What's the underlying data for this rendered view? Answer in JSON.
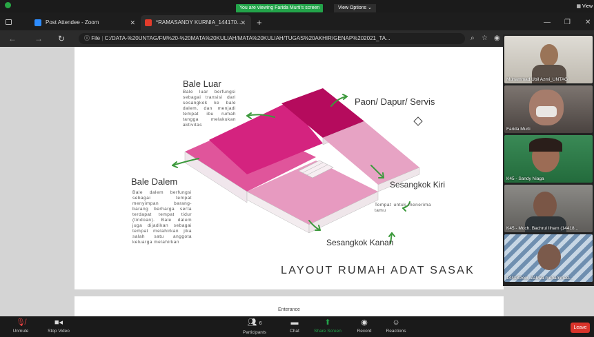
{
  "banner": {
    "viewing": "You are viewing Farida Murti's screen",
    "view_options": "View Options ⌄",
    "view_right": "View"
  },
  "browser": {
    "tabs": [
      {
        "label": "Post Attendee - Zoom"
      },
      {
        "label": "*RAMASANDY KURNIA_144170..."
      }
    ],
    "address": {
      "file_label": "File",
      "url": "C:/DATA-%20UNTAG/FM%20-%20MATA%20KULIAH/MATA%20KULIAH/TUGAS%20AKHIR/GENAP%202021_TA..."
    }
  },
  "document": {
    "bale_luar": {
      "title": "Bale Luar",
      "desc": "Bale luar berfungsi sebagai transisi dari sesangkok ke bale dalem, dan menjadi tempat ibu rumah tangga melakukan aktivitas"
    },
    "paon": {
      "title": "Paon/ Dapur/ Servis"
    },
    "bale_dalem": {
      "title": "Bale Dalem",
      "desc": "Bale dalem berfungsi sebagai tempat menyimpan barang-barang berharga serta terdapat tempat tidur (tindoan). Bale dalem juga dijadikan sebagai tempat melahirkan jika salah satu anggota keluarga melahirkan"
    },
    "sesangkok_kiri": {
      "title": "Sesangkok Kiri",
      "desc": "Tempat untuk menerima tamu"
    },
    "sesangkok_kanan": {
      "title": "Sesangkok Kanan"
    },
    "heading": "LAYOUT RUMAH ADAT SASAK",
    "page2_text": "Enterance"
  },
  "participants_video": [
    {
      "name": "Muhammad Ubil Azmi_UNTAG"
    },
    {
      "name": "Farida Murti"
    },
    {
      "name": "K45 - Sandy Niaga"
    },
    {
      "name": "K45 - Moch. Bachrul Ilham (14418..."
    },
    {
      "name": "144180xxx_Zahwa muhammad..."
    }
  ],
  "toolbar": {
    "unmute": "Unmute",
    "stop_video": "Stop Video",
    "participants": "Participants",
    "participants_count": "6",
    "chat": "Chat",
    "share_screen": "Share Screen",
    "record": "Record",
    "reactions": "Reactions",
    "leave": "Leave"
  },
  "colors": {
    "share_green": "#23a44a",
    "leave_red": "#d9342b",
    "pink_dark": "#c8136e",
    "pink_mid": "#e0559b",
    "pink_light": "#e7a3c4",
    "arrow_green": "#3d9a3d"
  }
}
